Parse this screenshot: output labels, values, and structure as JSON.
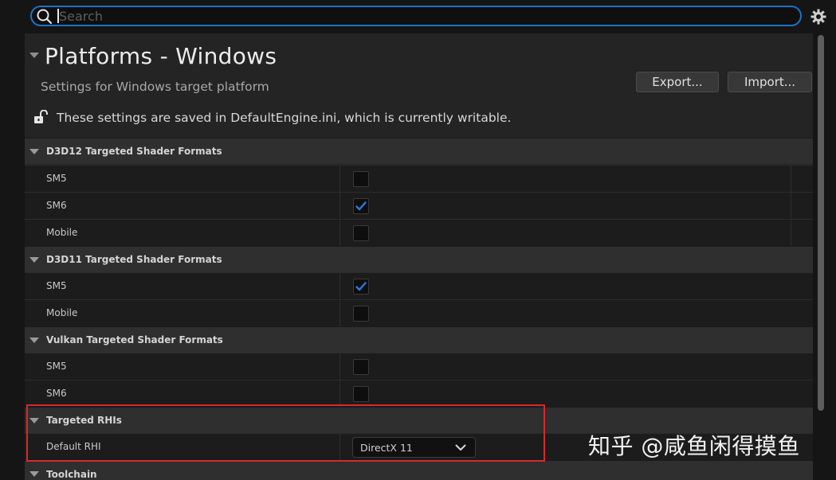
{
  "search": {
    "placeholder": "Search",
    "value": ""
  },
  "header": {
    "title": "Platforms - Windows",
    "subtitle": "Settings for Windows target platform",
    "export_label": "Export...",
    "import_label": "Import...",
    "save_message": "These settings are saved in DefaultEngine.ini, which is currently writable."
  },
  "sections": [
    {
      "title": "D3D12 Targeted Shader Formats",
      "rows": [
        {
          "label": "SM5",
          "checked": false
        },
        {
          "label": "SM6",
          "checked": true
        },
        {
          "label": "Mobile",
          "checked": false
        }
      ]
    },
    {
      "title": "D3D11 Targeted Shader Formats",
      "rows": [
        {
          "label": "SM5",
          "checked": true
        },
        {
          "label": "Mobile",
          "checked": false
        }
      ]
    },
    {
      "title": "Vulkan Targeted Shader Formats",
      "rows": [
        {
          "label": "SM5",
          "checked": false
        },
        {
          "label": "SM6",
          "checked": false
        }
      ]
    },
    {
      "title": "Targeted RHIs",
      "rows": [
        {
          "label": "Default RHI",
          "value": "DirectX 11"
        }
      ]
    },
    {
      "title": "Toolchain",
      "rows": []
    }
  ],
  "watermark": "知乎 @咸鱼闲得摸鱼",
  "icons": [
    "search-icon",
    "gear-icon",
    "unlock-icon",
    "collapse-arrow-icon",
    "checkmark-icon",
    "chevron-down-icon"
  ],
  "colors": {
    "accent": "#1a72c6",
    "highlight_box": "#d8282c",
    "check": "#2a7be0"
  }
}
